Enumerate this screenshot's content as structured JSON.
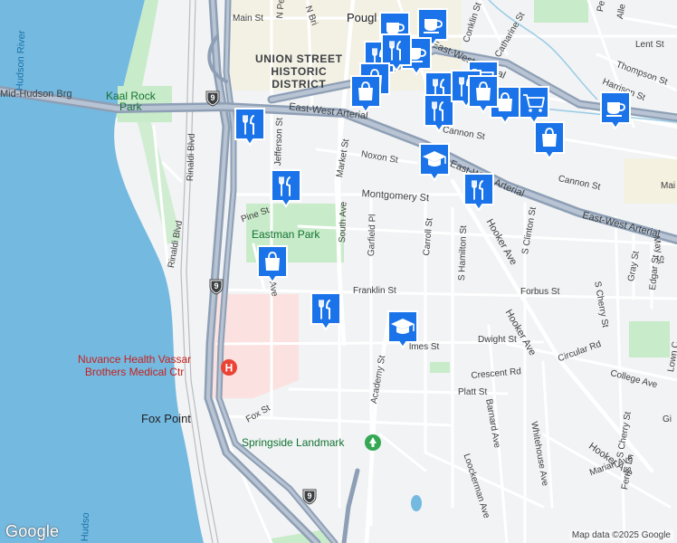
{
  "map": {
    "attribution": "Map data ©2025 Google",
    "logo": "Google",
    "colors": {
      "water": "#74b9e0",
      "land": "#f1f3f4",
      "park": "#c8ebc9",
      "hospital_area": "#fbe1df",
      "highway": "#8e9fb5",
      "arterial": "#8e9fb5",
      "street": "#ffffff",
      "rail": "#b9bcc1",
      "district": "#f5efd9",
      "pin_fill": "#1a73e8"
    },
    "labels": {
      "water_hudson_north": "Hudson River",
      "water_hudson_south": "Hudso",
      "bridge": "Mid-Hudson Brg",
      "historic_district": "UNION STREET\nHISTORIC\nDISTRICT",
      "city": "Pougl",
      "kaal_rock": "Kaal Rock\nPark",
      "eastman": "Eastman Park",
      "springside": "Springside Landmark",
      "hospital": "Nuvance Health Vassar\nBrothers Medical Ctr",
      "fox_point": "Fox Point",
      "main_st": "Main St",
      "n_pe": "N Pe",
      "n_bri": "N Bri",
      "conklin": "Conklin St",
      "catharine": "Catharine St",
      "lent": "Lent St",
      "thompson": "Thompson St",
      "harrison": "Harrison St",
      "alle": "Alle",
      "pe": "Pe",
      "ew_arterial_w": "East-West Arterial",
      "ew_arterial_n": "East-West Arterial",
      "ew_arterial_mid": "East-West Arterial",
      "ew_arterial_e": "East-West Arterial",
      "cannon_upper": "Cannon St",
      "cannon": "Cannon St",
      "noxon": "Noxon St",
      "market": "Market St",
      "jefferson": "Jefferson St",
      "rinaldi": "Rinaldi Blvd",
      "riverside": "Rinaldi Blvd",
      "pine": "Pine St",
      "montgomery": "Montgomery St",
      "south_ave": "South Ave",
      "garfield": "Garfield Pl",
      "carroll": "Carroll St",
      "s_hamilton": "S Hamilton St",
      "hooker_upper": "Hooker Ave",
      "hooker_lower": "Hooker Ave",
      "s_clinton": "S Clinton St",
      "s_cherry_upper": "S Cherry St",
      "gray": "Gray St",
      "edgar": "Edgar St",
      "may": "May St",
      "main_e": "Mai",
      "ln_ave": "ln Ave",
      "franklin": "Franklin St",
      "forbus": "Forbus St",
      "dwight": "Dwight St",
      "james": "lmes St",
      "circular": "Circular Rd",
      "crescent": "Crescent Rd",
      "college": "College Ave",
      "lown": "Lown C",
      "platt": "Platt St",
      "academy": "Academy St",
      "barnard": "Barnard Ave",
      "whitehouse": "Whitehouse Ave",
      "s_cherry_lower": "S Cherry St",
      "loockerman": "Loockerman Ave",
      "marian": "Marian Ave",
      "ferris": "Ferris Ln",
      "fox_st": "Fox St",
      "gi": "Gi"
    },
    "shields": {
      "us9_top": "9",
      "us9_mid": "9",
      "us9_bottom": "9"
    },
    "pins": {
      "restaurant": "restaurant-icon",
      "shopping": "shopping-bag-icon",
      "cafe": "cafe-icon",
      "school": "school-icon",
      "grocery": "grocery-cart-icon"
    }
  }
}
